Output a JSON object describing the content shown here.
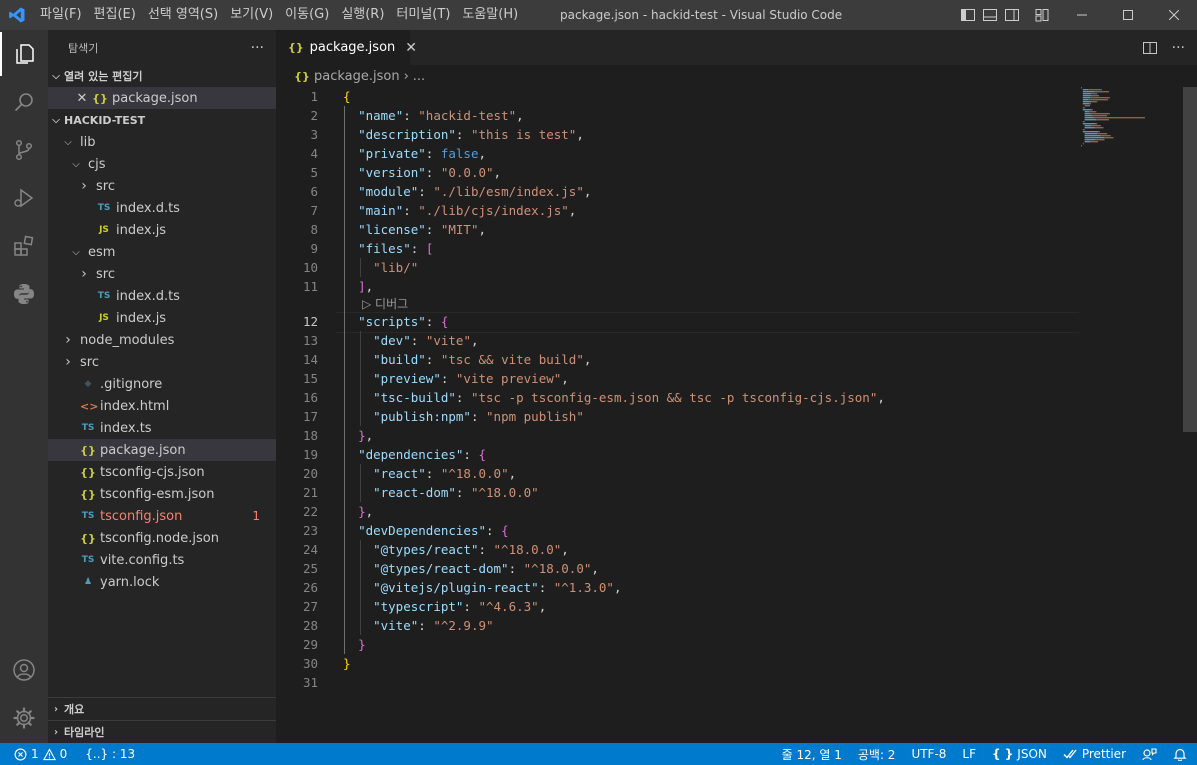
{
  "titlebar": {
    "menus": [
      "파일(F)",
      "편집(E)",
      "선택 영역(S)",
      "보기(V)",
      "이동(G)",
      "실행(R)",
      "터미널(T)",
      "도움말(H)"
    ],
    "title": "package.json - hackid-test - Visual Studio Code"
  },
  "sidebar": {
    "header": "탐색기",
    "more": "···",
    "open_editors": {
      "label": "열려 있는 편집기",
      "items": [
        {
          "name": "package.json"
        }
      ]
    },
    "project": {
      "label": "HACKID-TEST",
      "tree": [
        {
          "name": "lib",
          "type": "folder",
          "open": true,
          "depth": 0
        },
        {
          "name": "cjs",
          "type": "folder",
          "open": true,
          "depth": 1
        },
        {
          "name": "src",
          "type": "folder",
          "open": false,
          "depth": 2
        },
        {
          "name": "index.d.ts",
          "type": "ts",
          "depth": 2
        },
        {
          "name": "index.js",
          "type": "js",
          "depth": 2
        },
        {
          "name": "esm",
          "type": "folder",
          "open": true,
          "depth": 1
        },
        {
          "name": "src",
          "type": "folder",
          "open": false,
          "depth": 2
        },
        {
          "name": "index.d.ts",
          "type": "ts",
          "depth": 2
        },
        {
          "name": "index.js",
          "type": "js",
          "depth": 2
        },
        {
          "name": "node_modules",
          "type": "folder",
          "open": false,
          "depth": 0
        },
        {
          "name": "src",
          "type": "folder",
          "open": false,
          "depth": 0
        },
        {
          "name": ".gitignore",
          "type": "git",
          "depth": 0
        },
        {
          "name": "index.html",
          "type": "html",
          "depth": 0
        },
        {
          "name": "index.ts",
          "type": "ts",
          "depth": 0
        },
        {
          "name": "package.json",
          "type": "json",
          "depth": 0,
          "selected": true
        },
        {
          "name": "tsconfig-cjs.json",
          "type": "json",
          "depth": 0
        },
        {
          "name": "tsconfig-esm.json",
          "type": "json",
          "depth": 0
        },
        {
          "name": "tsconfig.json",
          "type": "tsjson",
          "depth": 0,
          "error": true,
          "badge": "1"
        },
        {
          "name": "tsconfig.node.json",
          "type": "json",
          "depth": 0
        },
        {
          "name": "vite.config.ts",
          "type": "ts",
          "depth": 0
        },
        {
          "name": "yarn.lock",
          "type": "yarn",
          "depth": 0
        }
      ]
    },
    "outline_label": "개요",
    "timeline_label": "타임라인"
  },
  "editor": {
    "tab_label": "package.json",
    "breadcrumb": {
      "file": "package.json",
      "more": "..."
    },
    "codelens": "▷ 디버그",
    "current_line": 12,
    "line_numbers": [
      "1",
      "2",
      "3",
      "4",
      "5",
      "6",
      "7",
      "8",
      "9",
      "10",
      "11",
      "12",
      "13",
      "14",
      "15",
      "16",
      "17",
      "18",
      "19",
      "20",
      "21",
      "22",
      "23",
      "24",
      "25",
      "26",
      "27",
      "28",
      "29",
      "30",
      "31"
    ],
    "code": [
      [
        [
          "br1",
          "{"
        ]
      ],
      [
        [
          "p",
          "  "
        ],
        [
          "k",
          "\"name\""
        ],
        [
          "p",
          ": "
        ],
        [
          "s",
          "\"hackid-test\""
        ],
        [
          "p",
          ","
        ]
      ],
      [
        [
          "p",
          "  "
        ],
        [
          "k",
          "\"description\""
        ],
        [
          "p",
          ": "
        ],
        [
          "s",
          "\"this is test\""
        ],
        [
          "p",
          ","
        ]
      ],
      [
        [
          "p",
          "  "
        ],
        [
          "k",
          "\"private\""
        ],
        [
          "p",
          ": "
        ],
        [
          "b",
          "false"
        ],
        [
          "p",
          ","
        ]
      ],
      [
        [
          "p",
          "  "
        ],
        [
          "k",
          "\"version\""
        ],
        [
          "p",
          ": "
        ],
        [
          "s",
          "\"0.0.0\""
        ],
        [
          "p",
          ","
        ]
      ],
      [
        [
          "p",
          "  "
        ],
        [
          "k",
          "\"module\""
        ],
        [
          "p",
          ": "
        ],
        [
          "s",
          "\"./lib/esm/index.js\""
        ],
        [
          "p",
          ","
        ]
      ],
      [
        [
          "p",
          "  "
        ],
        [
          "k",
          "\"main\""
        ],
        [
          "p",
          ": "
        ],
        [
          "s",
          "\"./lib/cjs/index.js\""
        ],
        [
          "p",
          ","
        ]
      ],
      [
        [
          "p",
          "  "
        ],
        [
          "k",
          "\"license\""
        ],
        [
          "p",
          ": "
        ],
        [
          "s",
          "\"MIT\""
        ],
        [
          "p",
          ","
        ]
      ],
      [
        [
          "p",
          "  "
        ],
        [
          "k",
          "\"files\""
        ],
        [
          "p",
          ": "
        ],
        [
          "br2",
          "["
        ]
      ],
      [
        [
          "p",
          "    "
        ],
        [
          "s",
          "\"lib/\""
        ]
      ],
      [
        [
          "p",
          "  "
        ],
        [
          "br2",
          "]"
        ],
        [
          "p",
          ","
        ]
      ],
      [
        [
          "p",
          "  "
        ],
        [
          "k",
          "\"scripts\""
        ],
        [
          "p",
          ": "
        ],
        [
          "br2",
          "{"
        ]
      ],
      [
        [
          "p",
          "    "
        ],
        [
          "k",
          "\"dev\""
        ],
        [
          "p",
          ": "
        ],
        [
          "s",
          "\"vite\""
        ],
        [
          "p",
          ","
        ]
      ],
      [
        [
          "p",
          "    "
        ],
        [
          "k",
          "\"build\""
        ],
        [
          "p",
          ": "
        ],
        [
          "s",
          "\"tsc && vite build\""
        ],
        [
          "p",
          ","
        ]
      ],
      [
        [
          "p",
          "    "
        ],
        [
          "k",
          "\"preview\""
        ],
        [
          "p",
          ": "
        ],
        [
          "s",
          "\"vite preview\""
        ],
        [
          "p",
          ","
        ]
      ],
      [
        [
          "p",
          "    "
        ],
        [
          "k",
          "\"tsc-build\""
        ],
        [
          "p",
          ": "
        ],
        [
          "s",
          "\"tsc -p tsconfig-esm.json && tsc -p tsconfig-cjs.json\""
        ],
        [
          "p",
          ","
        ]
      ],
      [
        [
          "p",
          "    "
        ],
        [
          "k",
          "\"publish:npm\""
        ],
        [
          "p",
          ": "
        ],
        [
          "s",
          "\"npm publish\""
        ]
      ],
      [
        [
          "p",
          "  "
        ],
        [
          "br2",
          "}"
        ],
        [
          "p",
          ","
        ]
      ],
      [
        [
          "p",
          "  "
        ],
        [
          "k",
          "\"dependencies\""
        ],
        [
          "p",
          ": "
        ],
        [
          "br2",
          "{"
        ]
      ],
      [
        [
          "p",
          "    "
        ],
        [
          "k",
          "\"react\""
        ],
        [
          "p",
          ": "
        ],
        [
          "s",
          "\"^18.0.0\""
        ],
        [
          "p",
          ","
        ]
      ],
      [
        [
          "p",
          "    "
        ],
        [
          "k",
          "\"react-dom\""
        ],
        [
          "p",
          ": "
        ],
        [
          "s",
          "\"^18.0.0\""
        ]
      ],
      [
        [
          "p",
          "  "
        ],
        [
          "br2",
          "}"
        ],
        [
          "p",
          ","
        ]
      ],
      [
        [
          "p",
          "  "
        ],
        [
          "k",
          "\"devDependencies\""
        ],
        [
          "p",
          ": "
        ],
        [
          "br2",
          "{"
        ]
      ],
      [
        [
          "p",
          "    "
        ],
        [
          "k",
          "\"@types/react\""
        ],
        [
          "p",
          ": "
        ],
        [
          "s",
          "\"^18.0.0\""
        ],
        [
          "p",
          ","
        ]
      ],
      [
        [
          "p",
          "    "
        ],
        [
          "k",
          "\"@types/react-dom\""
        ],
        [
          "p",
          ": "
        ],
        [
          "s",
          "\"^18.0.0\""
        ],
        [
          "p",
          ","
        ]
      ],
      [
        [
          "p",
          "    "
        ],
        [
          "k",
          "\"@vitejs/plugin-react\""
        ],
        [
          "p",
          ": "
        ],
        [
          "s",
          "\"^1.3.0\""
        ],
        [
          "p",
          ","
        ]
      ],
      [
        [
          "p",
          "    "
        ],
        [
          "k",
          "\"typescript\""
        ],
        [
          "p",
          ": "
        ],
        [
          "s",
          "\"^4.6.3\""
        ],
        [
          "p",
          ","
        ]
      ],
      [
        [
          "p",
          "    "
        ],
        [
          "k",
          "\"vite\""
        ],
        [
          "p",
          ": "
        ],
        [
          "s",
          "\"^2.9.9\""
        ]
      ],
      [
        [
          "p",
          "  "
        ],
        [
          "br2",
          "}"
        ]
      ],
      [
        [
          "br1",
          "}"
        ]
      ],
      []
    ]
  },
  "statusbar": {
    "errors": "1",
    "warnings": "0",
    "json_symbols": "{..} : 13",
    "position": "줄 12, 열 1",
    "spaces": "공백: 2",
    "encoding": "UTF-8",
    "eol": "LF",
    "language": "JSON",
    "prettier": "Prettier"
  },
  "colors": {
    "accent": "#007acc",
    "error": "#f88070",
    "json_key": "#9cdcfe",
    "json_string": "#ce9178",
    "json_bool": "#569cd6"
  }
}
